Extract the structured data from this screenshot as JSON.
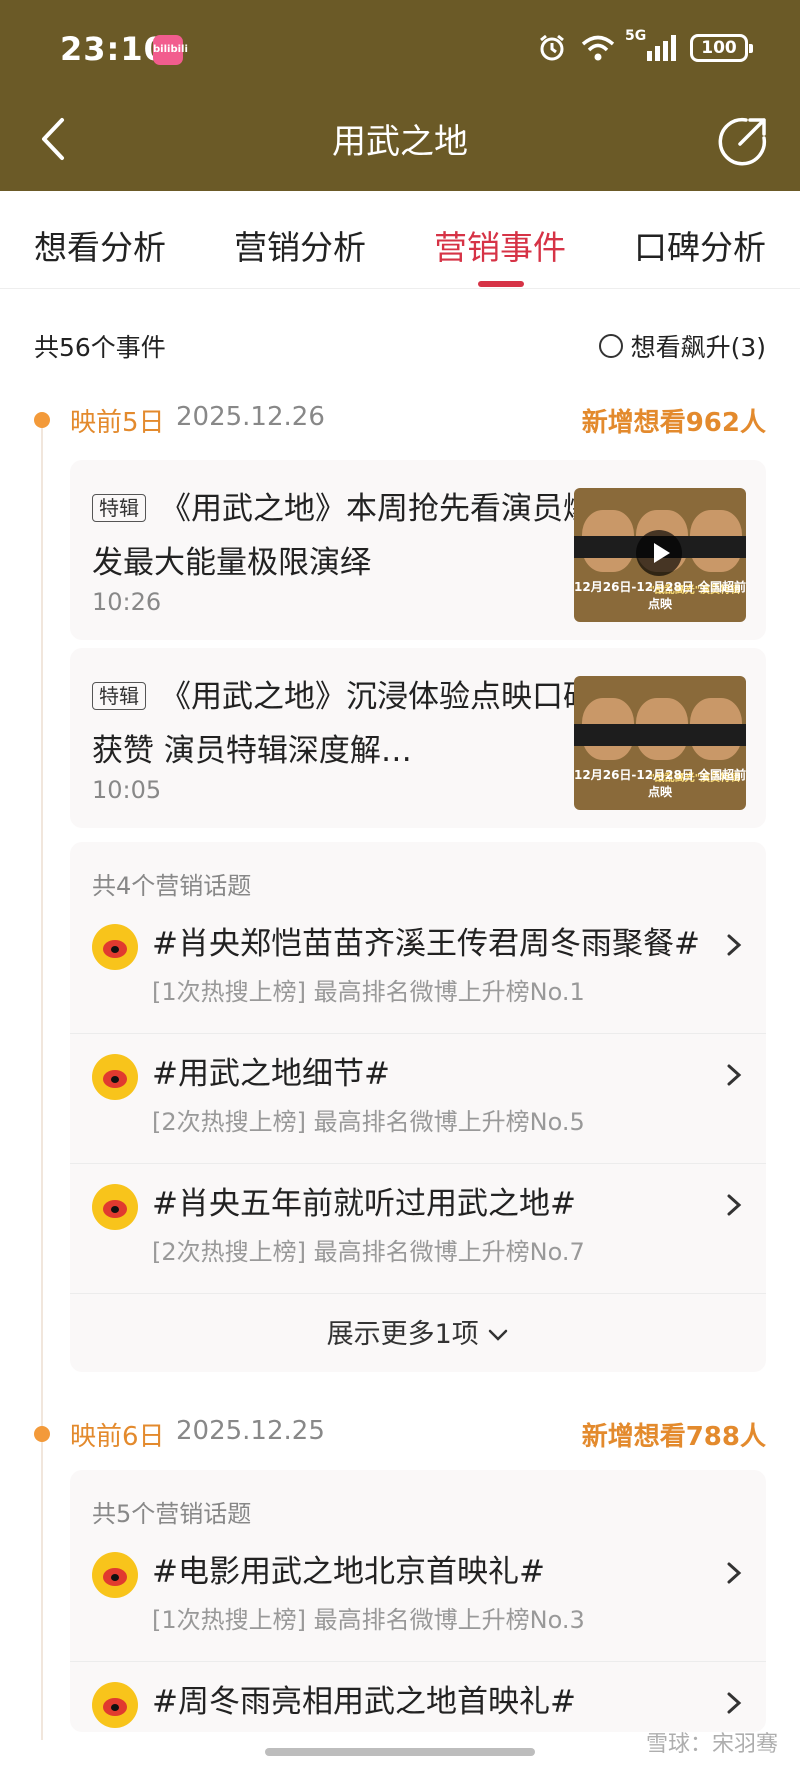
{
  "status_bar": {
    "time": "23:10",
    "app_badge": "bilibili",
    "network": "5G",
    "battery": "100"
  },
  "nav": {
    "title": "用武之地"
  },
  "tabs": [
    {
      "label": "想看分析"
    },
    {
      "label": "营销分析"
    },
    {
      "label": "营销事件",
      "active": true
    },
    {
      "label": "口碑分析"
    }
  ],
  "summary": {
    "count_text": "共56个事件",
    "filter_label": "想看飙升(3)"
  },
  "days": [
    {
      "label": "映前5日",
      "date": "2025.12.26",
      "growth": "新增想看962人",
      "events": [
        {
          "tag": "特辑",
          "title": "《用武之地》本周抢先看演员爆发最大能量极限演绎",
          "time": "10:26",
          "thumb_caption": "12月26日-12月28日 全国超前点映",
          "thumb_sub": "\"战乱高光\"演员特辑",
          "has_video": true
        },
        {
          "tag": "特辑",
          "title": "《用武之地》沉浸体验点映口碑获赞 演员特辑深度解…",
          "time": "10:05",
          "thumb_caption": "12月26日-12月28日 全国超前点映",
          "thumb_sub": "\"战乱高光\"演员特辑",
          "has_video": false
        }
      ],
      "topics_header": "共4个营销话题",
      "topics": [
        {
          "title": "#肖央郑恺苗苗齐溪王传君周冬雨聚餐#",
          "sub": "[1次热搜上榜] 最高排名微博上升榜No.1"
        },
        {
          "title": "#用武之地细节#",
          "sub": "[2次热搜上榜] 最高排名微博上升榜No.5"
        },
        {
          "title": "#肖央五年前就听过用武之地#",
          "sub": "[2次热搜上榜] 最高排名微博上升榜No.7"
        }
      ],
      "show_more": "展示更多1项"
    },
    {
      "label": "映前6日",
      "date": "2025.12.25",
      "growth": "新增想看788人",
      "topics_header": "共5个营销话题",
      "topics": [
        {
          "title": "#电影用武之地北京首映礼#",
          "sub": "[1次热搜上榜] 最高排名微博上升榜No.3"
        },
        {
          "title": "#周冬雨亮相用武之地首映礼#",
          "sub": ""
        }
      ]
    }
  ],
  "watermark": "雪球：宋羽骞",
  "colors": {
    "header_bg": "#6b5a27",
    "accent_red": "#d63346",
    "accent_orange": "#e38a2d"
  }
}
